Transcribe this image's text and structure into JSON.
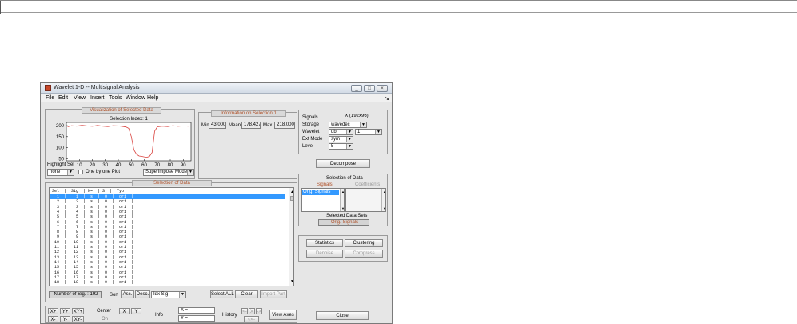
{
  "window": {
    "title": "Wavelet 1-D  --  Multisignal Analysis",
    "controls": [
      "_",
      "□",
      "×"
    ]
  },
  "menubar": [
    "File",
    "Edit",
    "View",
    "Insert",
    "Tools",
    "Window",
    "Help"
  ],
  "visualization": {
    "title": "Visualization of Selected Data",
    "selection_index": "Selection Index: 1",
    "highlight_label": "Highlight Sel",
    "highlight_value": "none",
    "only_one_plot_label": "One by one Plot",
    "mode_value": "Superimpose Mode"
  },
  "chart_data": {
    "type": "line",
    "title": "Selection Index: 1",
    "xlabel": "",
    "ylabel": "",
    "xlim": [
      0,
      96
    ],
    "ylim": [
      40,
      215
    ],
    "xticks": [
      10,
      20,
      30,
      40,
      50,
      60,
      70,
      80,
      90
    ],
    "yticks": [
      50,
      100,
      150,
      200
    ],
    "series": [
      {
        "color": "#d9413d",
        "x": [
          1,
          4,
          8,
          12,
          16,
          20,
          24,
          28,
          32,
          36,
          40,
          44,
          46,
          48,
          50,
          52,
          54,
          56,
          58,
          60,
          62,
          64,
          66,
          68,
          70,
          74,
          78,
          82,
          86,
          90,
          94
        ],
        "y": [
          195,
          200,
          198,
          202,
          199,
          197,
          201,
          198,
          196,
          200,
          199,
          196,
          194,
          188,
          150,
          90,
          70,
          62,
          60,
          58,
          56,
          60,
          78,
          175,
          195,
          198,
          196,
          200,
          197,
          199,
          198
        ]
      }
    ]
  },
  "information": {
    "title": "Information on Selection 1",
    "min_label": "Min",
    "min_value": "43.000",
    "mean_label": "Mean",
    "mean_value": "178.427",
    "max_label": "Max",
    "max_value": "218.000"
  },
  "selection": {
    "title": "Selection of Data",
    "header": " Sel  |  Sig  | N=  | S  |  Typ  |",
    "rows": [
      "   1  |    1  |  s  |  0  |  ori  |",
      "   2  |    2  |  s  |  0  |  ori  |",
      "   3  |    3  |  s  |  0  |  ori  |",
      "   4  |    4  |  s  |  0  |  ori  |",
      "   5  |    5  |  s  |  0  |  ori  |",
      "   6  |    6  |  s  |  0  |  ori  |",
      "   7  |    7  |  s  |  0  |  ori  |",
      "   8  |    8  |  s  |  0  |  ori  |",
      "   9  |    9  |  s  |  0  |  ori  |",
      "  10  |   10  |  s  |  0  |  ori  |",
      "  11  |   11  |  s  |  0  |  ori  |",
      "  12  |   12  |  s  |  0  |  ori  |",
      "  13  |   13  |  s  |  0  |  ori  |",
      "  14  |   14  |  s  |  0  |  ori  |",
      "  15  |   15  |  s  |  0  |  ori  |",
      "  16  |   16  |  s  |  0  |  ori  |",
      "  17  |   17  |  s  |  0  |  ori  |",
      "  18  |   18  |  s  |  0  |  ori  |"
    ],
    "number_of_sig": "Number of Sig. : 192",
    "sort_label": "Sort",
    "asc_label": "Asc.",
    "desc_label": "Desc.",
    "sort_by": "Idx Sig",
    "select_all_label": "Select ALL",
    "clear_label": "Clear",
    "import_part_label": "Import Part"
  },
  "bottom": {
    "zoom_buttons": [
      "X+",
      "Y+",
      "XY+",
      "X-",
      "Y-",
      "XY-"
    ],
    "center_label": "Center",
    "center_sub": "On",
    "x_btn": "X",
    "y_btn": "Y",
    "info_label": "Info",
    "x_eq": "X =",
    "y_eq": "Y =",
    "history_label": "History",
    "history_btns": [
      "<-",
      "X",
      "->",
      "<<-"
    ],
    "view_axes_label": "View Axes"
  },
  "right": {
    "signals_label": "Signals",
    "signals_value": "X (192x96)",
    "storage_label": "Storage",
    "storage_value": "wavedec",
    "wavelet_label": "Wavelet",
    "wavelet_family": "db",
    "wavelet_number": "1",
    "ext_label": "Ext Mode",
    "ext_value": "sym",
    "level_label": "Level",
    "level_value": "5",
    "decompose_label": "Decompose",
    "sel_of_data_title": "Selection of Data",
    "signals_col": "Signals",
    "coeffs_col": "Coefficients",
    "signals_list_item": "Orig. Signals",
    "selected_data_sets_label": "Selected Data Sets",
    "selected_data_sets_value": "Orig. Signals",
    "statistics_label": "Statistics",
    "clustering_label": "Clustering",
    "denoise_label": "Denoise",
    "compress_label": "Compress",
    "close_label": "Close"
  }
}
